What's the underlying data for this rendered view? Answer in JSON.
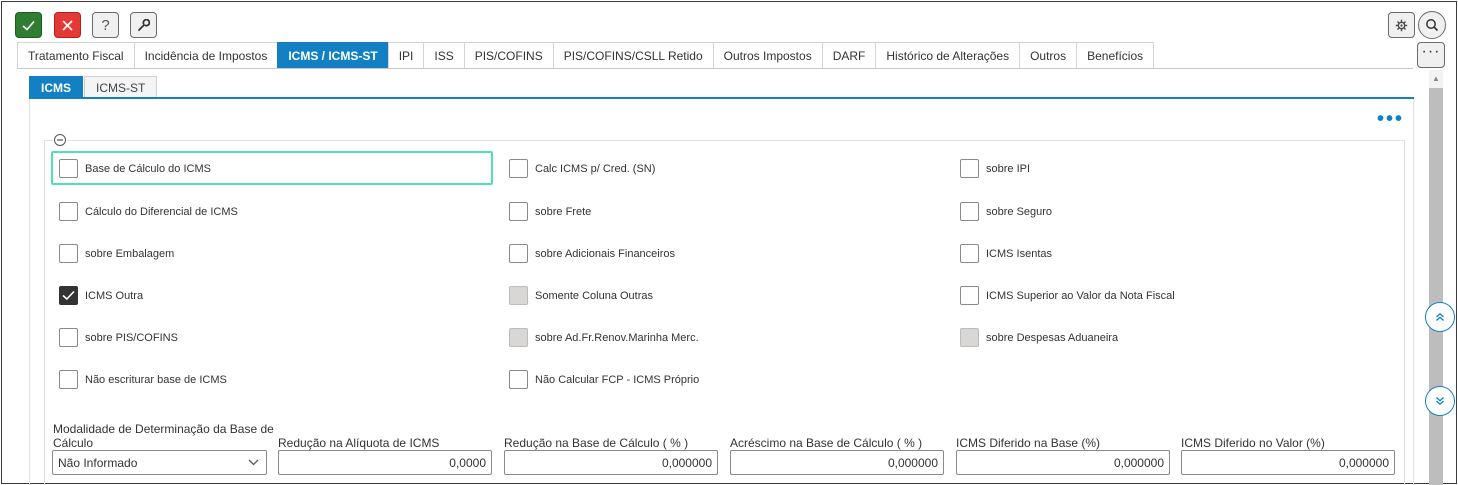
{
  "toolbar": {
    "confirm_icon": "check-icon",
    "cancel_icon": "close-icon",
    "help_label": "?",
    "tools_icon": "wrench-icon",
    "settings_icon": "gear-icon",
    "search_icon": "search-icon",
    "more_label": "···"
  },
  "tabs": [
    {
      "label": "Tratamento Fiscal",
      "active": false
    },
    {
      "label": "Incidência de Impostos",
      "active": false
    },
    {
      "label": "ICMS / ICMS-ST",
      "active": true
    },
    {
      "label": "IPI",
      "active": false
    },
    {
      "label": "ISS",
      "active": false
    },
    {
      "label": "PIS/COFINS",
      "active": false
    },
    {
      "label": "PIS/COFINS/CSLL Retido",
      "active": false
    },
    {
      "label": "Outros Impostos",
      "active": false
    },
    {
      "label": "DARF",
      "active": false
    },
    {
      "label": "Histórico de Alterações",
      "active": false
    },
    {
      "label": "Outros",
      "active": false
    },
    {
      "label": "Benefícios",
      "active": false
    }
  ],
  "subtabs": [
    {
      "label": "ICMS",
      "active": true
    },
    {
      "label": "ICMS-ST",
      "active": false
    }
  ],
  "panel": {
    "more_label": "•••"
  },
  "checkboxes": [
    {
      "label": "Base de Cálculo do ICMS",
      "state": "unchecked"
    },
    {
      "label": "Calc ICMS p/ Cred. (SN)",
      "state": "unchecked"
    },
    {
      "label": "sobre IPI",
      "state": "unchecked"
    },
    {
      "label": "Cálculo do Diferencial de ICMS",
      "state": "unchecked"
    },
    {
      "label": "sobre Frete",
      "state": "unchecked"
    },
    {
      "label": "sobre Seguro",
      "state": "unchecked"
    },
    {
      "label": "sobre Embalagem",
      "state": "unchecked"
    },
    {
      "label": "sobre Adicionais Financeiros",
      "state": "unchecked"
    },
    {
      "label": "ICMS Isentas",
      "state": "unchecked"
    },
    {
      "label": "ICMS Outra",
      "state": "checked"
    },
    {
      "label": "Somente Coluna Outras",
      "state": "disabled"
    },
    {
      "label": "ICMS Superior ao Valor da Nota Fiscal",
      "state": "unchecked"
    },
    {
      "label": "sobre PIS/COFINS",
      "state": "unchecked"
    },
    {
      "label": "sobre Ad.Fr.Renov.Marinha Merc.",
      "state": "disabled"
    },
    {
      "label": "sobre Despesas Aduaneira",
      "state": "disabled"
    },
    {
      "label": "Não escriturar base de ICMS",
      "state": "unchecked"
    },
    {
      "label": "Não Calcular FCP - ICMS Próprio",
      "state": "unchecked"
    }
  ],
  "fields": {
    "modalidade": {
      "label_line1": "Modalidade de Determinação da Base de",
      "label_line2": "Cálculo",
      "value": "Não Informado"
    },
    "reducao_aliquota": {
      "label": "Redução na Alíquota de ICMS",
      "value": "0,0000"
    },
    "reducao_base": {
      "label": "Redução na Base de Cálculo ( % )",
      "value": "0,000000"
    },
    "acrescimo_base": {
      "label": "Acréscimo na Base de Cálculo ( % )",
      "value": "0,000000"
    },
    "diferido_base": {
      "label": "ICMS Diferido na Base (%)",
      "value": "0,000000"
    },
    "diferido_valor": {
      "label": "ICMS Diferido no Valor (%)",
      "value": "0,000000"
    }
  }
}
